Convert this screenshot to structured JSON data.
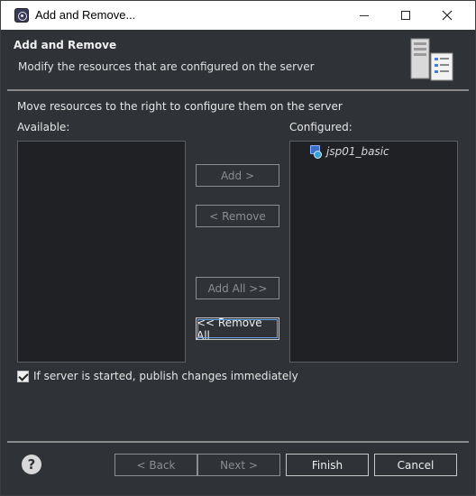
{
  "window": {
    "title": "Add and Remove..."
  },
  "banner": {
    "title": "Add and Remove",
    "description": "Modify the resources that are configured on the server",
    "image_icon": "server-config-icon"
  },
  "content": {
    "instruction": "Move resources to the right to configure them on the server",
    "available_label": "Available:",
    "configured_label": "Configured:",
    "available_items": [],
    "configured_items": [
      {
        "label": "jsp01_basic",
        "icon": "web-project-icon"
      }
    ],
    "buttons": {
      "add": "Add >",
      "remove": "< Remove",
      "add_all": "Add All >>",
      "remove_all": "<< Remove All"
    },
    "publish_checkbox": {
      "label": "If server is started, publish changes immediately",
      "checked": true
    }
  },
  "footer": {
    "back": "< Back",
    "next": "Next >",
    "finish": "Finish",
    "cancel": "Cancel"
  }
}
